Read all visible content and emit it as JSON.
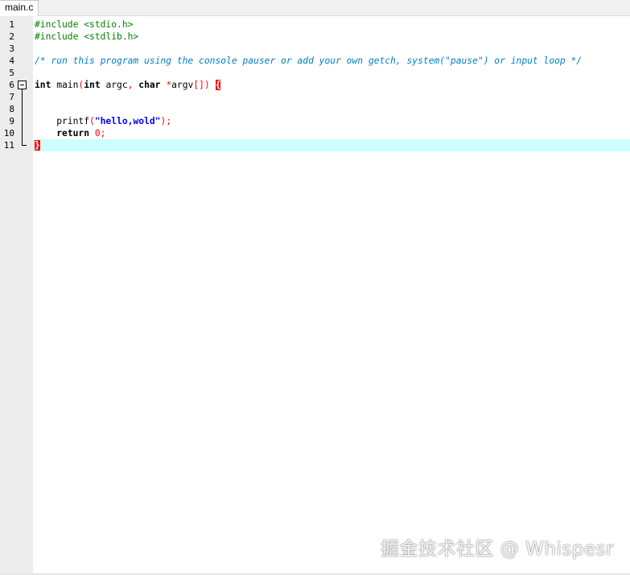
{
  "tab": {
    "label": "main.c"
  },
  "editor": {
    "current_line": 11,
    "lines": [
      {
        "num": "1",
        "segments": [
          {
            "cls": "c-pre",
            "text": "#include <stdio.h>"
          }
        ]
      },
      {
        "num": "2",
        "segments": [
          {
            "cls": "c-pre",
            "text": "#include <stdlib.h>"
          }
        ]
      },
      {
        "num": "3",
        "segments": []
      },
      {
        "num": "4",
        "segments": [
          {
            "cls": "c-com",
            "text": "/* run this program using the console pauser or add your own getch, system(\"pause\") or input loop */"
          }
        ]
      },
      {
        "num": "5",
        "segments": []
      },
      {
        "num": "6",
        "segments": [
          {
            "cls": "c-kw",
            "text": "int"
          },
          {
            "cls": "",
            "text": " main"
          },
          {
            "cls": "c-op",
            "text": "("
          },
          {
            "cls": "c-kw",
            "text": "int"
          },
          {
            "cls": "",
            "text": " argc"
          },
          {
            "cls": "c-op",
            "text": ","
          },
          {
            "cls": "",
            "text": " "
          },
          {
            "cls": "c-kw",
            "text": "char"
          },
          {
            "cls": "",
            "text": " "
          },
          {
            "cls": "c-op",
            "text": "*"
          },
          {
            "cls": "",
            "text": "argv"
          },
          {
            "cls": "c-op",
            "text": "[])"
          },
          {
            "cls": "",
            "text": " "
          },
          {
            "cls": "brace-match",
            "text": "{"
          }
        ]
      },
      {
        "num": "7",
        "segments": []
      },
      {
        "num": "8",
        "segments": []
      },
      {
        "num": "9",
        "segments": [
          {
            "cls": "",
            "text": "    printf"
          },
          {
            "cls": "c-op",
            "text": "("
          },
          {
            "cls": "c-str",
            "text": "\"hello,wold\""
          },
          {
            "cls": "c-op",
            "text": ");"
          }
        ]
      },
      {
        "num": "10",
        "segments": [
          {
            "cls": "",
            "text": "    "
          },
          {
            "cls": "c-kw",
            "text": "return"
          },
          {
            "cls": "",
            "text": " "
          },
          {
            "cls": "c-num",
            "text": "0"
          },
          {
            "cls": "c-op",
            "text": ";"
          }
        ]
      },
      {
        "num": "11",
        "segments": [
          {
            "cls": "brace-match",
            "text": "}"
          }
        ]
      }
    ]
  },
  "watermark": {
    "text": "掘金技术社区 @ Whispesr"
  },
  "colors": {
    "current_line_highlight": "#ccffff",
    "brace_match": "#ff0000",
    "preprocessor": "#008000",
    "comment": "#0080c0",
    "string": "#0000ff"
  }
}
